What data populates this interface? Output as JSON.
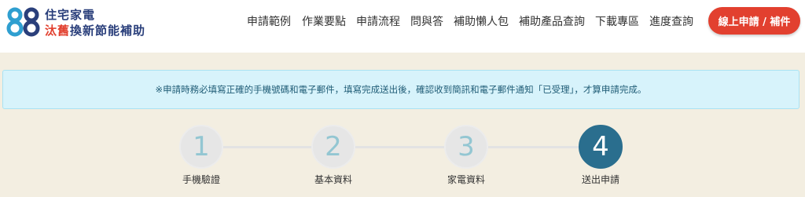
{
  "logo": {
    "line1": "住宅家電",
    "line2_red": "汰舊",
    "line2_navy": "換新節能補助",
    "icon": "88-logo-icon"
  },
  "nav": {
    "items": [
      {
        "label": "申請範例"
      },
      {
        "label": "作業要點"
      },
      {
        "label": "申請流程"
      },
      {
        "label": "問與答"
      },
      {
        "label": "補助懶人包"
      },
      {
        "label": "補助產品查詢"
      },
      {
        "label": "下載專區"
      },
      {
        "label": "進度查詢"
      }
    ],
    "cta_label": "線上申請 / 補件"
  },
  "notice": {
    "text": "※申請時務必填寫正確的手機號碼和電子郵件，填寫完成送出後，確認收到簡訊和電子郵件通知「已受理」，才算申請完成。"
  },
  "stepper": {
    "steps": [
      {
        "number": "1",
        "label": "手機驗證"
      },
      {
        "number": "2",
        "label": "基本資料"
      },
      {
        "number": "3",
        "label": "家電資料"
      },
      {
        "number": "4",
        "label": "送出申請"
      }
    ],
    "active_step": 4
  },
  "colors": {
    "brand_red": "#e2402f",
    "brand_navy": "#2a3f7b",
    "active_step": "#2a6e8e",
    "notice_bg": "#d7f3fb"
  }
}
